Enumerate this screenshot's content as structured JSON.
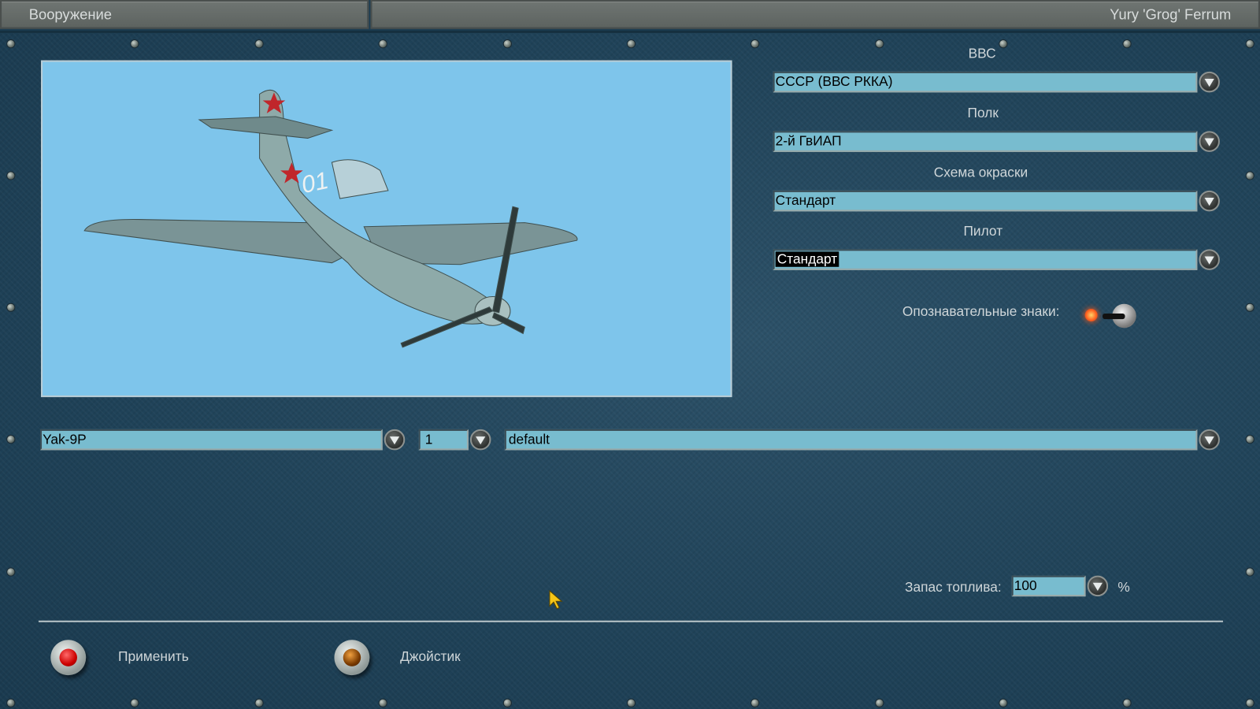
{
  "header": {
    "title": "Вооружение",
    "user": "Yury 'Grog' Ferrum"
  },
  "form": {
    "air_force": {
      "label": "ВВС",
      "value": "СССР (ВВС РККА)"
    },
    "regiment": {
      "label": "Полк",
      "value": "2-й ГвИАП"
    },
    "skin": {
      "label": "Схема окраски",
      "value": "Стандарт"
    },
    "pilot": {
      "label": "Пилот",
      "value": "Стандарт"
    },
    "markings": {
      "label": "Опознавательные знаки:",
      "enabled": true
    }
  },
  "loadout": {
    "aircraft": "Yak-9P",
    "count": "1",
    "weapons": "default"
  },
  "fuel": {
    "label": "Запас топлива:",
    "value": "100",
    "unit": "%"
  },
  "preview": {
    "tail_number": "01"
  },
  "buttons": {
    "apply": "Применить",
    "joystick": "Джойстик"
  },
  "colors": {
    "field": "#78bccf",
    "panel": "#1f4258",
    "sky": "#7ec5eb"
  }
}
